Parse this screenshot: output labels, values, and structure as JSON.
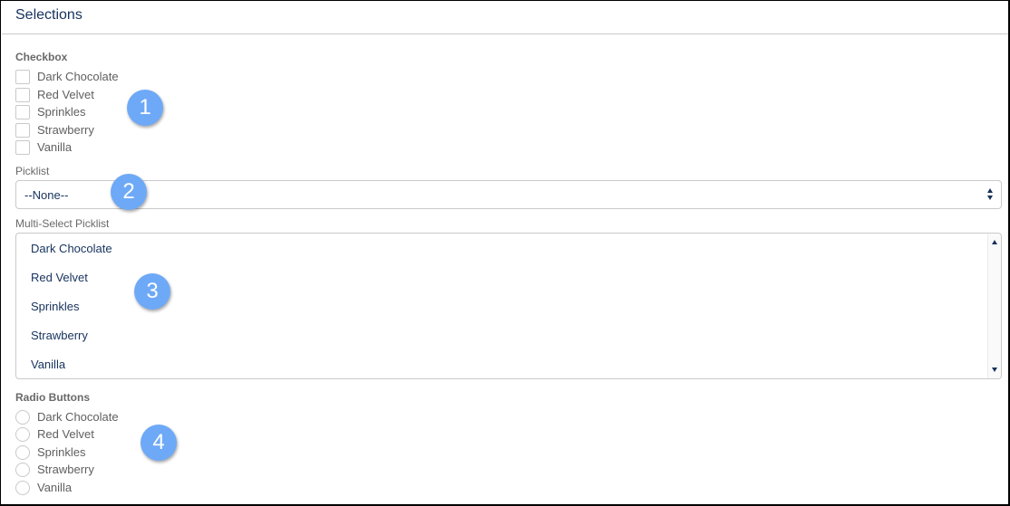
{
  "header": {
    "title": "Selections"
  },
  "checkbox_section": {
    "label": "Checkbox",
    "options": [
      {
        "label": "Dark Chocolate",
        "checked": false
      },
      {
        "label": "Red Velvet",
        "checked": false
      },
      {
        "label": "Sprinkles",
        "checked": false
      },
      {
        "label": "Strawberry",
        "checked": false
      },
      {
        "label": "Vanilla",
        "checked": false
      }
    ]
  },
  "picklist_section": {
    "label": "Picklist",
    "selected": "--None--"
  },
  "multiselect_section": {
    "label": "Multi-Select Picklist",
    "options": [
      "Dark Chocolate",
      "Red Velvet",
      "Sprinkles",
      "Strawberry",
      "Vanilla"
    ]
  },
  "radio_section": {
    "label": "Radio Buttons",
    "options": [
      {
        "label": "Dark Chocolate",
        "selected": false
      },
      {
        "label": "Red Velvet",
        "selected": false
      },
      {
        "label": "Sprinkles",
        "selected": false
      },
      {
        "label": "Strawberry",
        "selected": false
      },
      {
        "label": "Vanilla",
        "selected": false
      }
    ]
  },
  "badges": [
    "1",
    "2",
    "3",
    "4"
  ],
  "colors": {
    "badge": "#6ea9f7",
    "title": "#16325c",
    "border": "#c9c9c9"
  }
}
